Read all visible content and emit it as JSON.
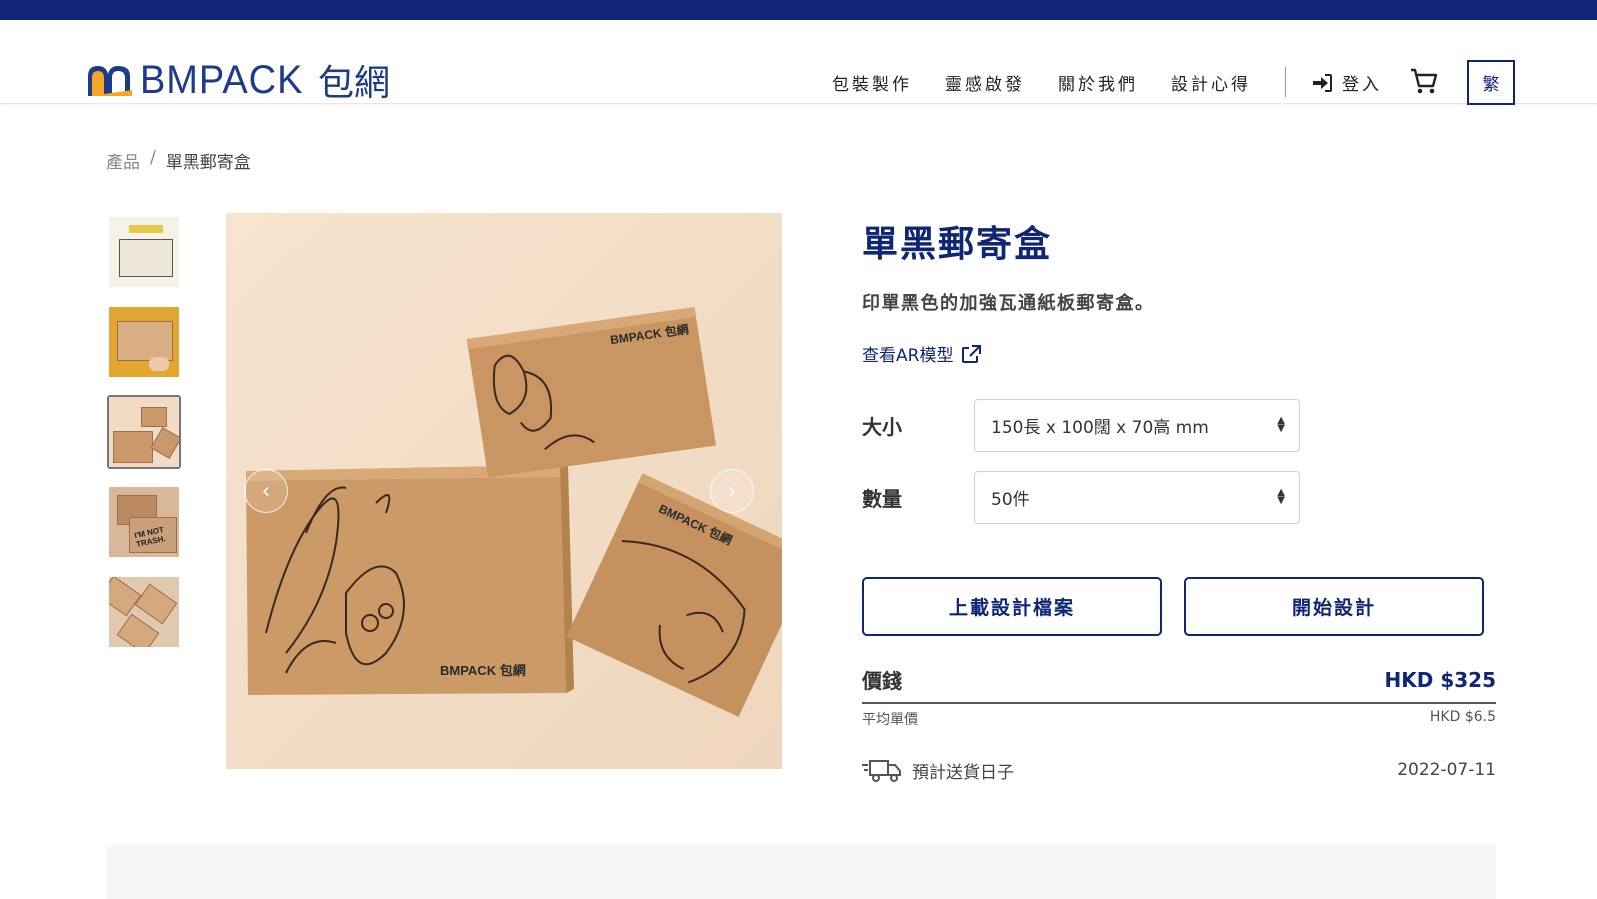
{
  "header": {
    "logo_text": "BMPACK",
    "logo_cn": "包網",
    "nav": [
      "包裝製作",
      "靈感啟發",
      "關於我們",
      "設計心得"
    ],
    "login_label": "登入",
    "lang_label": "繁"
  },
  "breadcrumb": {
    "root": "產品",
    "separator": "/",
    "current": "單黑郵寄盒"
  },
  "product": {
    "title": "單黑郵寄盒",
    "description": "印單黑色的加強瓦通紙板郵寄盒。",
    "ar_link": "查看AR模型",
    "size_label": "大小",
    "size_value": "150長 x 100闊 x 70高 mm",
    "qty_label": "數量",
    "qty_value": "50件",
    "upload_button": "上載設計檔案",
    "design_button": "開始設計",
    "price_label": "價錢",
    "price_value": "HKD $325",
    "unit_label": "平均單價",
    "unit_value": "HKD $6.5",
    "ship_label": "預計送貨日子",
    "ship_date": "2022-07-11"
  },
  "gallery": {
    "active_index": 2,
    "box_brand": "BMPACK 包網",
    "thumb4_text": "I'M NOT TRASH."
  },
  "colors": {
    "brand_navy": "#0f2575",
    "logo_orange": "#f5a623",
    "kraft": "#c9996b"
  }
}
